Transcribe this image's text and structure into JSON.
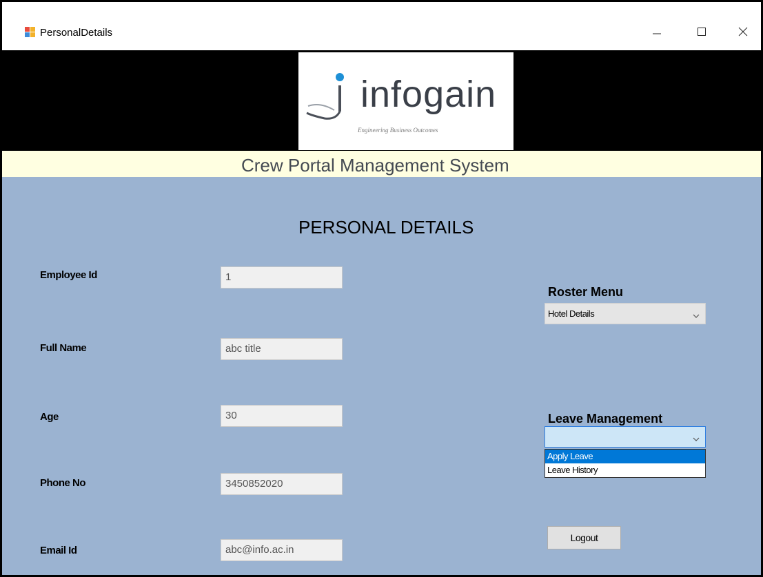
{
  "window": {
    "title": "PersonalDetails",
    "controls": {
      "minimize": "minimize-icon",
      "maximize": "maximize-icon",
      "close": "close-icon"
    }
  },
  "banner": {
    "logo_text": "infogain",
    "logo_tagline": "Engineering Business Outcomes",
    "system_title": "Crew Portal Management System"
  },
  "main": {
    "heading": "PERSONAL DETAILS",
    "fields": [
      {
        "label": "Employee Id",
        "value": "1"
      },
      {
        "label": "Full Name",
        "value": "abc title"
      },
      {
        "label": "Age",
        "value": "30"
      },
      {
        "label": "Phone No",
        "value": "3450852020"
      },
      {
        "label": "Email Id",
        "value": "abc@info.ac.in"
      }
    ],
    "roster_menu": {
      "label": "Roster Menu",
      "selected": "Hotel Details"
    },
    "leave_management": {
      "label": "Leave Management",
      "selected": "",
      "options": [
        "Apply Leave",
        "Leave History"
      ],
      "highlighted": "Apply Leave"
    },
    "logout_label": "Logout"
  },
  "colors": {
    "main_bg": "#9bb3d1",
    "strip_bg": "#ffffe1",
    "banner_bg": "#000000",
    "highlight": "#0078d7"
  }
}
